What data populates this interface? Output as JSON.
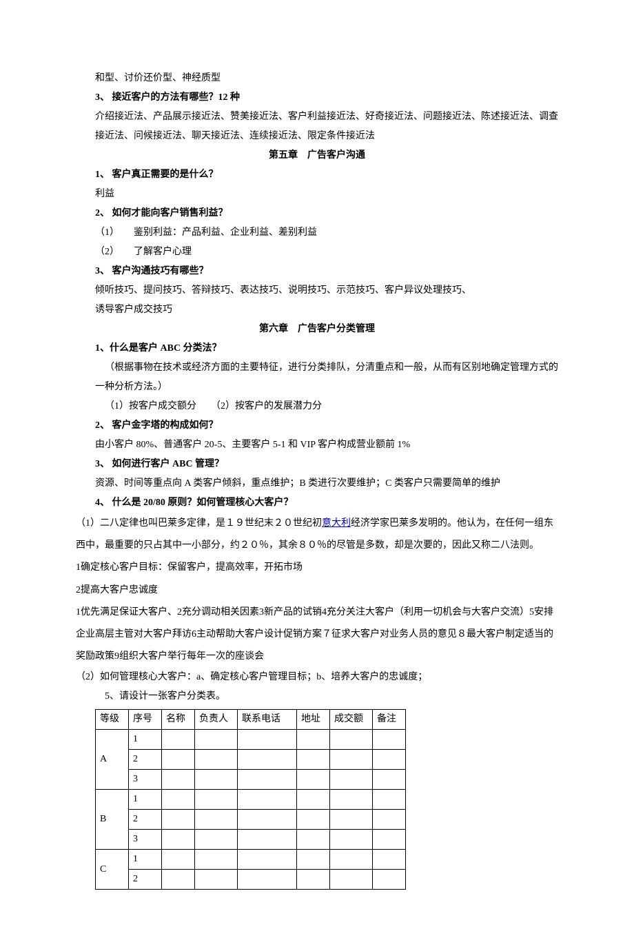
{
  "intro_line": "和型、讨价还价型、神经质型",
  "q3_title": "3、 接近客户的方法有哪些？12 种",
  "q3_body": "介绍接近法、产品展示接近法、赞美接近法、客户利益接近法、好奇接近法、问题接近法、陈述接近法、调查接近法、问候接近法、聊天接近法、连续接近法、限定条件接近法",
  "ch5_title": "第五章　广告客户沟通",
  "ch5_q1": "1、 客户真正需要的是什么？",
  "ch5_a1": "利益",
  "ch5_q2": "2、 如何才能向客户销售利益？",
  "ch5_a2_1": "（1）　　鉴别利益：产品利益、企业利益、差别利益",
  "ch5_a2_2": "（2）　　了解客户心理",
  "ch5_q3": "3、 客户沟通技巧有哪些？",
  "ch5_a3_1": "倾听技巧、提问技巧、答辩技巧、表达技巧、说明技巧、示范技巧、客户异议处理技巧、",
  "ch5_a3_2": "诱导客户成交技巧",
  "ch6_title": "第六章　广告客户分类管理",
  "ch6_q1": "1、什么是客户 ABC 分类法？",
  "ch6_a1": "（根据事物在技术或经济方面的主要特征，进行分类排队，分清重点和一般，从而有区别地确定管理方式的一种分析方法。）",
  "ch6_a1_sub": "（1）按客户成交额分　　（2）按客户的发展潜力分",
  "ch6_q2": "2、 客户金字塔的构成如何？",
  "ch6_a2": "由小客户 80%、普通客户 20-5、主要客户 5-1 和 VIP 客户构成营业额前 1%",
  "ch6_q3": "3、 如何进行客户 ABC 管理？",
  "ch6_a3": "资源、时间等重点向 A 类客户倾斜，重点维护；B 类进行次要维护；C 类客户只需要简单的维护",
  "ch6_q4": "4、 什么是 20/80 原则？如何管理核心大客户？",
  "ch6_a4_p1_pre": "（1）二八定律也叫巴莱多定律，是１９世纪末２０世纪初",
  "ch6_a4_p1_link": "意大利",
  "ch6_a4_p1_post": "经济学家巴莱多发明的。他认为，在任何一组东西中，最重要的只占其中一小部分，约２０％，其余８０％的尽管是多数，却是次要的，因此又称二八法则。",
  "ch6_a4_p2": "1确定核心客户目标：保留客户，提高效率，开拓市场",
  "ch6_a4_p3": "2提高大客户忠诚度",
  "ch6_a4_p4": "1优先满足保证大客户、2充分调动相关因素3新产品的试销4充分关注大客户（利用一切机会与大客户交流）5安排企业高层主管对大客户拜访6主动帮助大客户设计促销方案７征求大客户对业务人员的意见８最大客户制定适当的奖励政策9组织大客户举行每年一次的座谈会",
  "ch6_a4_p5": "（2）如何管理核心大客户：a、确定核心客户管理目标；b、培养大客户的忠诚度；",
  "ch6_q5": "5、请设计一张客户分类表。",
  "table": {
    "headers": [
      "等级",
      "序号",
      "名称",
      "负责人",
      "联系电话",
      "地址",
      "成交额",
      "备注"
    ],
    "groups": [
      {
        "label": "A",
        "rows": [
          "1",
          "2",
          "3"
        ]
      },
      {
        "label": "B",
        "rows": [
          "1",
          "2",
          "3"
        ]
      },
      {
        "label": "C",
        "rows": [
          "1",
          "2"
        ]
      }
    ]
  }
}
